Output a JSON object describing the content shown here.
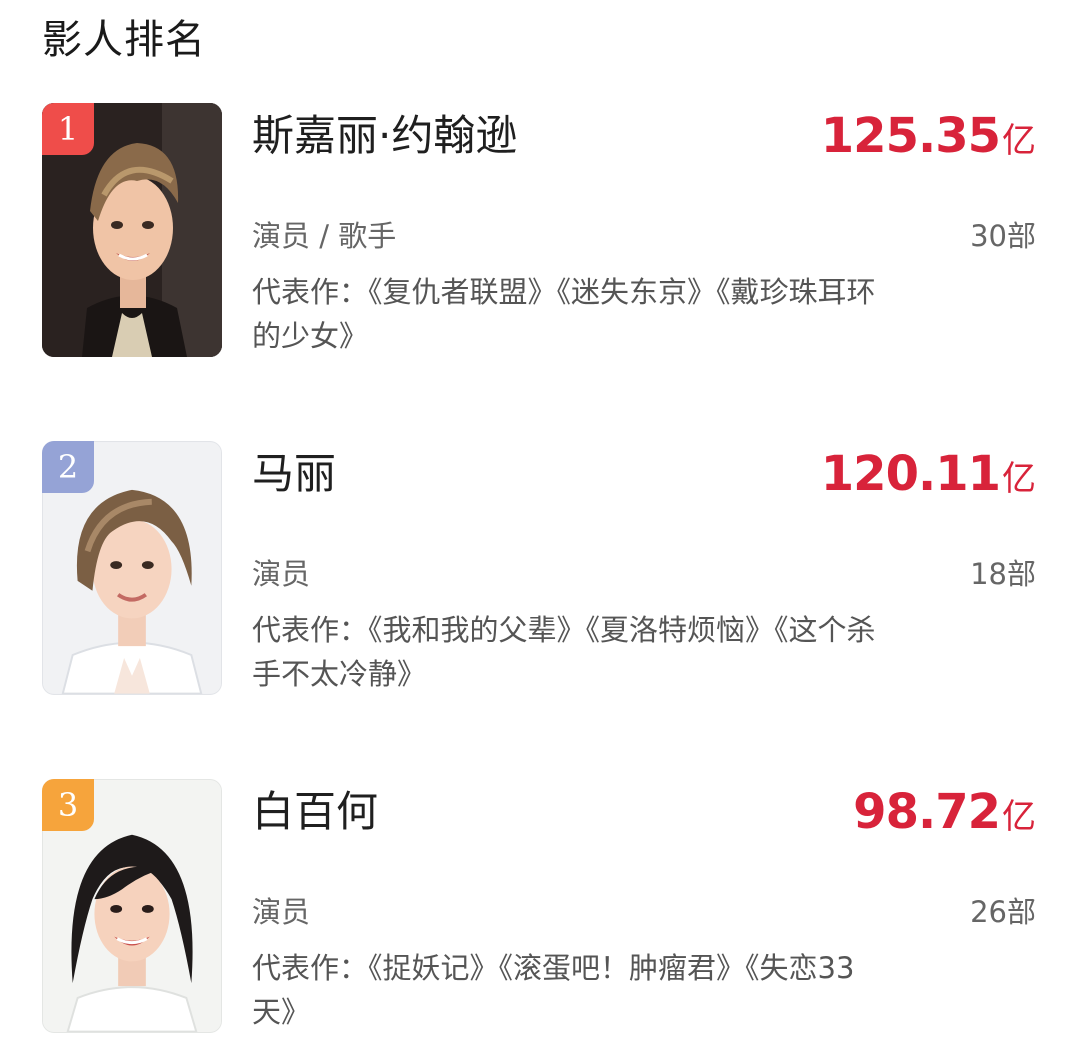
{
  "section": {
    "title": "影人排名"
  },
  "people": [
    {
      "rank": "1",
      "name": "斯嘉丽·约翰逊",
      "boxoffice_value": "125.35",
      "boxoffice_unit": "亿",
      "role": "演员 / 歌手",
      "works_count": "30部",
      "representative_works": "代表作：《复仇者联盟》《迷失东京》《戴珍珠耳环的少女》",
      "photo_icon": "portrait-photo"
    },
    {
      "rank": "2",
      "name": "马丽",
      "boxoffice_value": "120.11",
      "boxoffice_unit": "亿",
      "role": "演员",
      "works_count": "18部",
      "representative_works": "代表作：《我和我的父辈》《夏洛特烦恼》《这个杀手不太冷静》",
      "photo_icon": "portrait-photo"
    },
    {
      "rank": "3",
      "name": "白百何",
      "boxoffice_value": "98.72",
      "boxoffice_unit": "亿",
      "role": "演员",
      "works_count": "26部",
      "representative_works": "代表作：《捉妖记》《滚蛋吧！肿瘤君》《失恋33天》",
      "photo_icon": "portrait-photo"
    }
  ],
  "colors": {
    "accent_red": "#d8233a",
    "rank_1": "#ef4d4a",
    "rank_2": "#95a3d6",
    "rank_3": "#f6a43c"
  }
}
